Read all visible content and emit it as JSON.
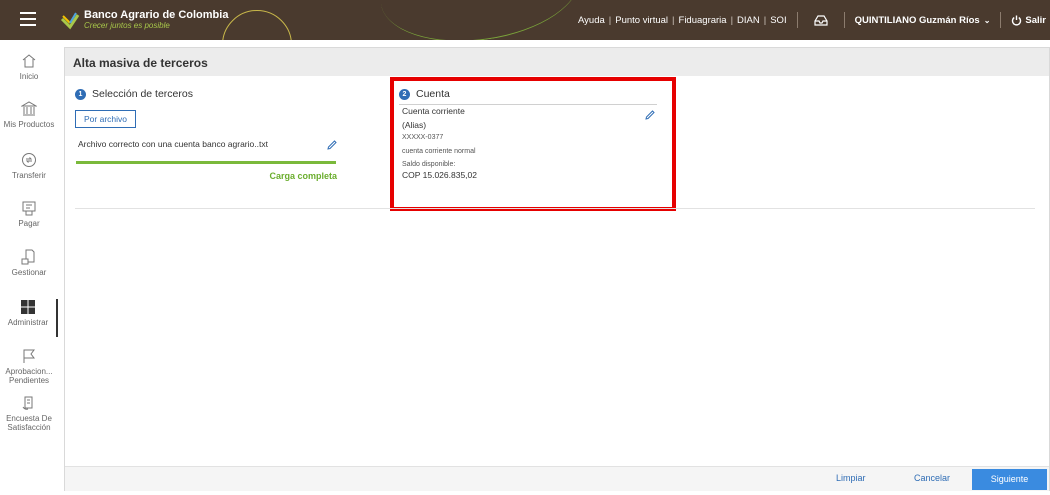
{
  "header": {
    "brand_name": "Banco Agrario de Colombia",
    "brand_tagline": "Crecer juntos es posible",
    "nav": [
      "Ayuda",
      "Punto virtual",
      "Fiduagraria",
      "DIAN",
      "SOI"
    ],
    "user_name": "QUINTILIANO Guzmán Ríos",
    "logout_label": "Salir",
    "icons": [
      "menu-icon",
      "inbox-icon",
      "power-icon"
    ]
  },
  "sidebar": {
    "items": [
      {
        "label": "Inicio",
        "icon": "home-icon"
      },
      {
        "label": "Mis Productos",
        "icon": "bank-icon"
      },
      {
        "label": "Transferir",
        "icon": "transfer-icon"
      },
      {
        "label": "Pagar",
        "icon": "pay-icon"
      },
      {
        "label": "Gestionar",
        "icon": "manage-icon"
      },
      {
        "label": "Administrar",
        "icon": "grid-icon"
      },
      {
        "label": "Aprobacion... Pendientes",
        "icon": "flag-icon"
      },
      {
        "label": "Encuesta De Satisfacción",
        "icon": "survey-icon"
      }
    ],
    "active": "Administrar"
  },
  "page": {
    "title": "Alta masiva de terceros",
    "step1": {
      "number": "1",
      "title": "Selección de terceros",
      "file_button": "Por archivo",
      "filename": "Archivo correcto con una cuenta banco agrario..txt",
      "progress_fraction": 1.0,
      "status": "Carga completa"
    },
    "step2": {
      "number": "2",
      "title": "Cuenta",
      "account_type": "Cuenta corriente",
      "alias": "(Alias)",
      "account_number": "XXXXX-0377",
      "account_subtype": "cuenta corriente normal",
      "balance_label": "Saldo disponible:",
      "balance_value": "COP 15.026.835,02"
    },
    "actions": {
      "clear": "Limpiar",
      "cancel": "Cancelar",
      "next": "Siguiente"
    }
  },
  "colors": {
    "header_bg": "#4a3a2e",
    "accent_blue": "#2f6db5",
    "primary_button": "#3a8be0",
    "progress_green": "#7ab93b",
    "highlight_red": "#e60000"
  }
}
